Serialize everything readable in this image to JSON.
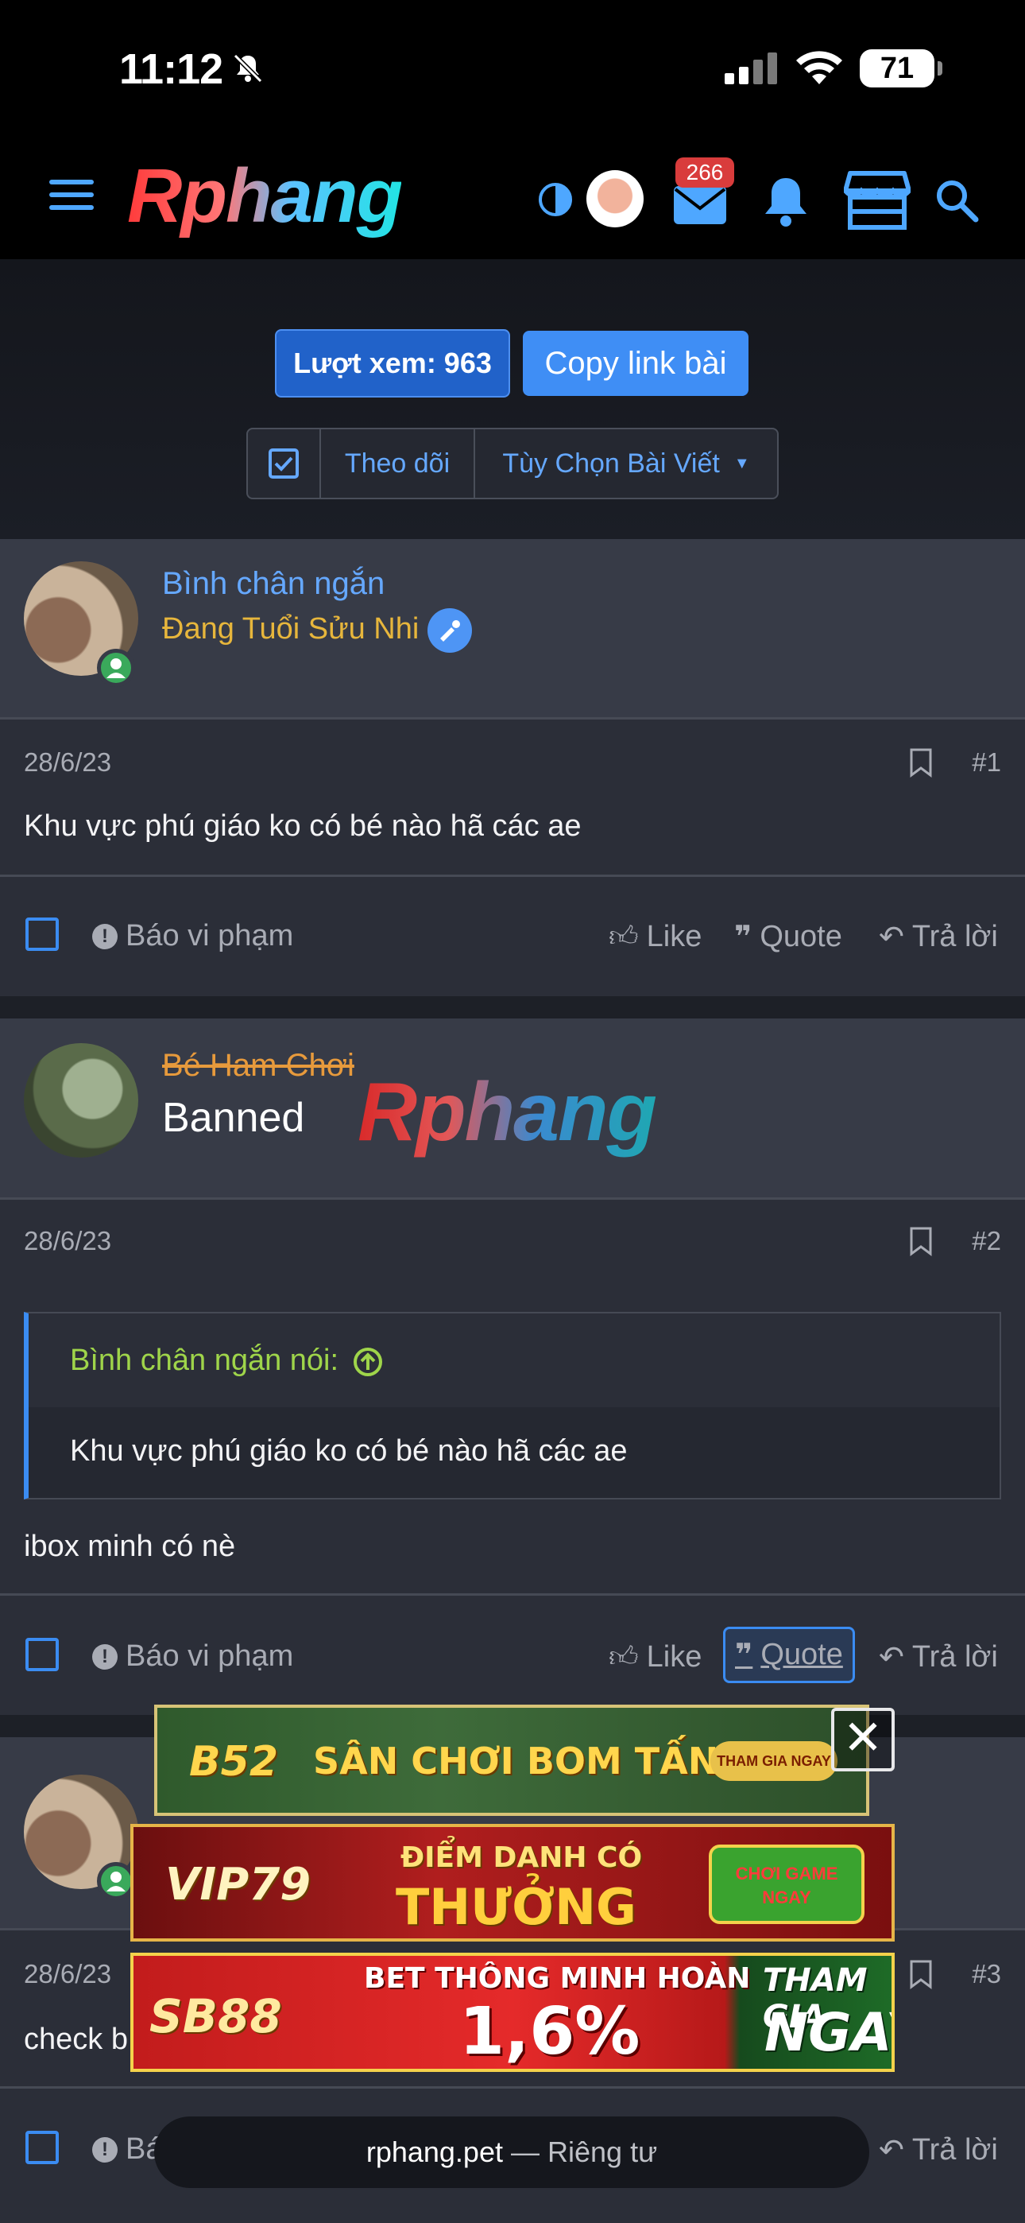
{
  "status_bar": {
    "time": "11:12",
    "battery": "71"
  },
  "header": {
    "logo_text": "Rphang",
    "notifications_count": "266"
  },
  "thread_tools": {
    "views_label": "Lượt xem: 963",
    "copy_link_label": "Copy link bài",
    "follow_label": "Theo dõi",
    "options_label": "Tùy Chọn Bài Viết"
  },
  "posts": [
    {
      "username": "Bình chân ngắn",
      "user_title": "Đang Tuổi Sửu Nhi",
      "date": "28/6/23",
      "number": "#1",
      "content": "Khu vực phú giáo ko có bé nào hã các ae"
    },
    {
      "username": "Bé Ham Chơi",
      "user_title": "Banned",
      "date": "28/6/23",
      "number": "#2",
      "quote_author": "Bình chân ngắn nói:",
      "quote_text": "Khu vực phú giáo ko có bé nào hã các ae",
      "content": "ibox minh có nè"
    },
    {
      "date": "28/6/23",
      "number": "#3",
      "content": "check b"
    }
  ],
  "actions": {
    "report": "Báo vi phạm",
    "like": "Like",
    "quote": "Quote",
    "reply": "Trả lời"
  },
  "watermark": "Rphang",
  "ads": {
    "b52": {
      "brand": "B52",
      "headline": "SÂN CHƠI BOM TẤN",
      "cta": "THAM GIA NGAY"
    },
    "vip79": {
      "brand": "VIP79",
      "line1": "ĐIỂM DANH CÓ",
      "line2": "THƯỞNG",
      "cta": "CHƠI GAME NGAY"
    },
    "sb88": {
      "brand": "SB88",
      "line1": "BET THÔNG MINH HOÀN",
      "line2": "1,6%",
      "cta_1": "THAM GIA",
      "cta_2": "NGAY"
    }
  },
  "browser": {
    "domain": "rphang.pet",
    "separator": " — ",
    "mode": "Riêng tư"
  }
}
